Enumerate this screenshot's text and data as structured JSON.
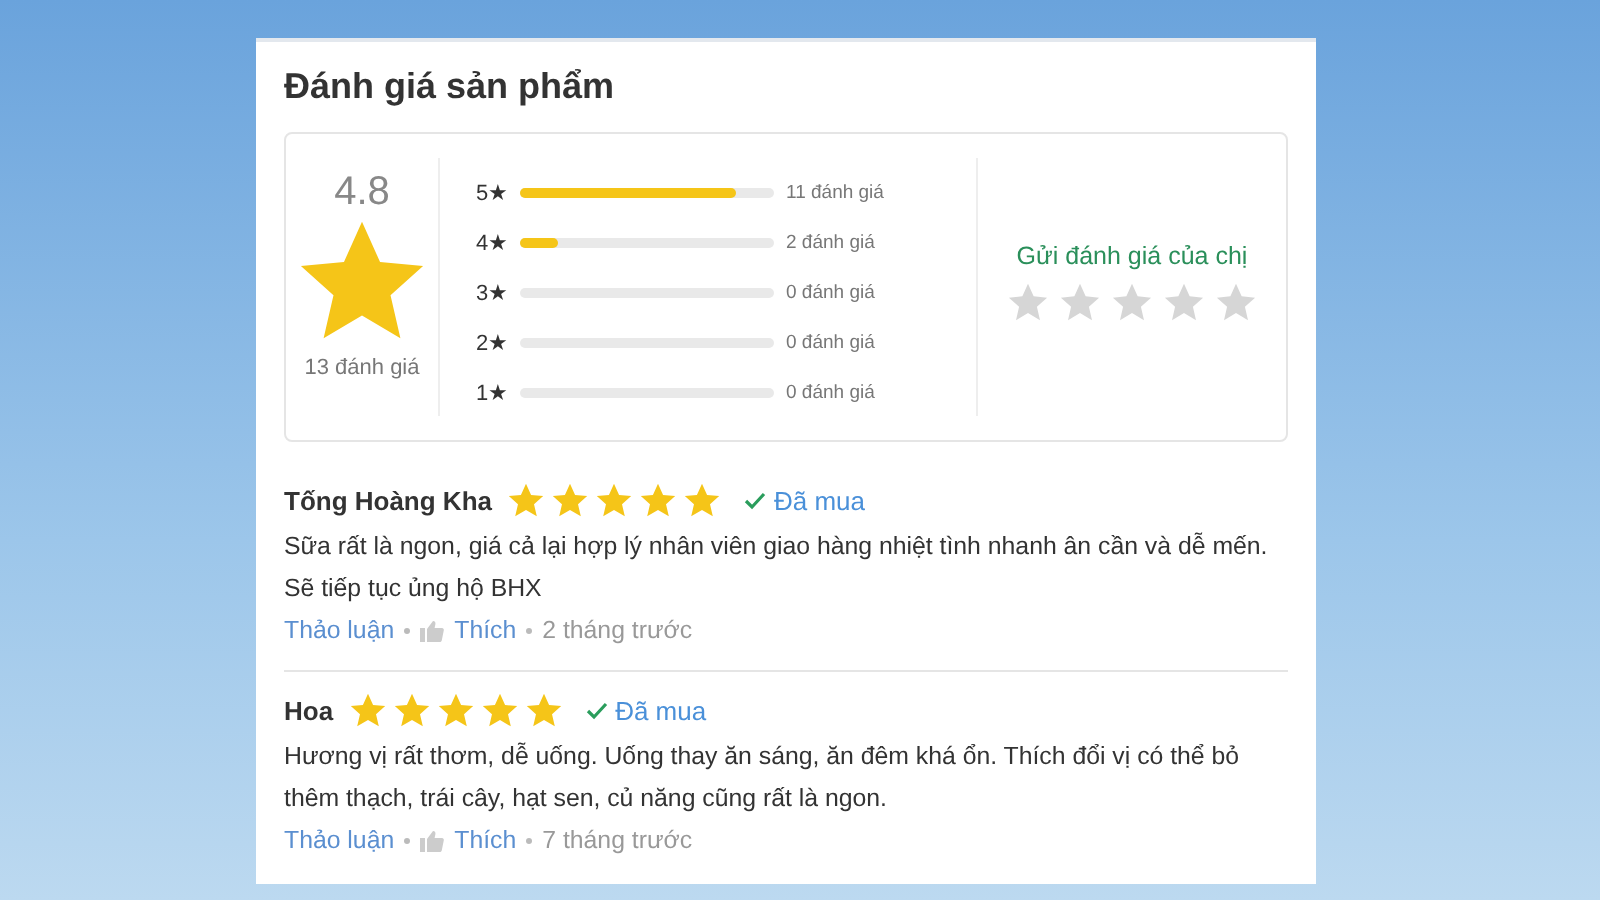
{
  "title": "Đánh giá sản phẩm",
  "summary": {
    "score": "4.8",
    "total": "13 đánh giá",
    "breakdown": [
      {
        "label": "5★",
        "level": 0.85,
        "count": "11 đánh giá"
      },
      {
        "label": "4★",
        "level": 0.15,
        "count": "2 đánh giá"
      },
      {
        "label": "3★",
        "level": 0,
        "count": "0 đánh giá"
      },
      {
        "label": "2★",
        "level": 0,
        "count": "0 đánh giá"
      },
      {
        "label": "1★",
        "level": 0,
        "count": "0 đánh giá"
      }
    ],
    "give_rating": {
      "label": "Gửi đánh giá của chị",
      "stars": 0
    }
  },
  "reviews": [
    {
      "name": "Tống Hoàng Kha",
      "stars": 5,
      "badge": "Đã mua",
      "text": "Sữa rất là ngon, giá cả lại hợp lý nhân viên giao hàng nhiệt tình nhanh ân cần và dễ mến. Sẽ tiếp tục ủng hộ BHX",
      "discuss": "Thảo luận",
      "like": "Thích",
      "time": "2 tháng trước"
    },
    {
      "name": "Hoa",
      "stars": 5,
      "badge": "Đã mua",
      "text": "Hương vị rất thơm, dễ uống. Uống thay ăn sáng, ăn đêm khá ổn. Thích đổi vị có thể bỏ thêm thạch, trái cây, hạt sen, củ năng cũng rất là ngon.",
      "discuss": "Thảo luận",
      "like": "Thích",
      "time": "7 tháng trước"
    }
  ]
}
